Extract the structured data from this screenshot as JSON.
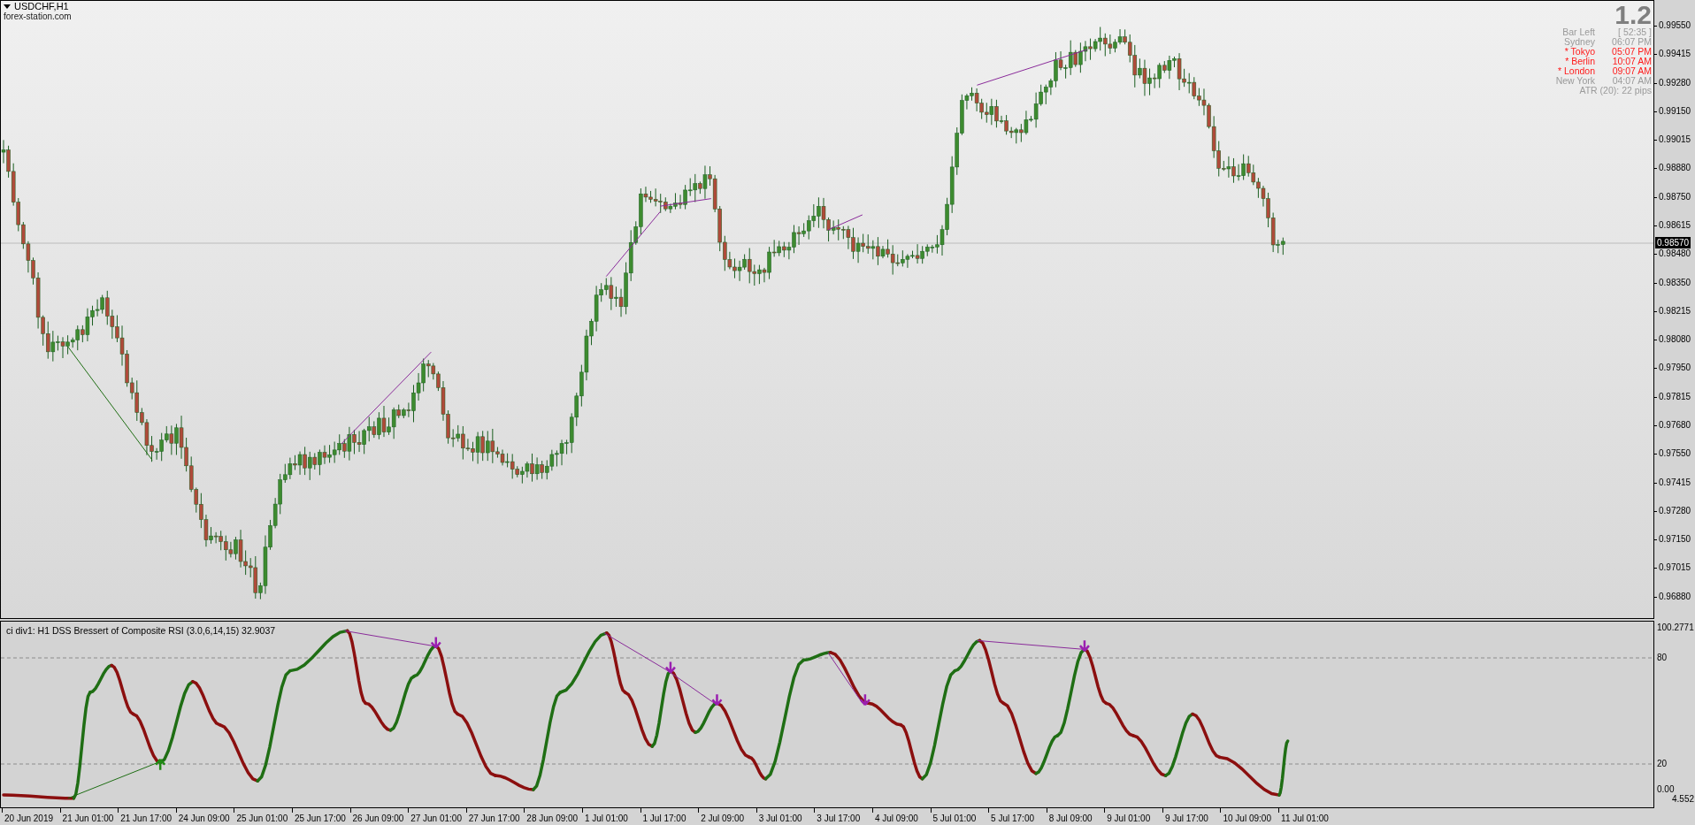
{
  "chart": {
    "symbol": "USDCHF,H1",
    "source": "forex-station.com",
    "spread": "1.2",
    "info_rows": [
      {
        "label": "Bar Left",
        "value": "[ 52:35 ]",
        "active": false
      },
      {
        "label": "Sydney",
        "value": "06:07 PM",
        "active": false
      },
      {
        "label": "* Tokyo",
        "value": "05:07 PM",
        "active": true
      },
      {
        "label": "* Berlin",
        "value": "10:07 AM",
        "active": true
      },
      {
        "label": "* London",
        "value": "09:07 AM",
        "active": true
      },
      {
        "label": "New York",
        "value": "04:07 AM",
        "active": false
      }
    ],
    "atr": "ATR (20): 22 pips",
    "price_axis": [
      "0.99550",
      "0.99415",
      "0.99280",
      "0.99150",
      "0.99015",
      "0.98880",
      "0.98750",
      "0.98615",
      "0.98480",
      "0.98350",
      "0.98215",
      "0.98080",
      "0.97950",
      "0.97815",
      "0.97680",
      "0.97550",
      "0.97415",
      "0.97280",
      "0.97150",
      "0.97015",
      "0.96880"
    ],
    "current_price": "0.98570"
  },
  "indicator": {
    "title": "ci div1: H1 DSS Bressert of Composite RSI (3.0,6,14,15) 32.9037",
    "max": "100.2771",
    "upper": "80",
    "lower": "20",
    "zero": "0.00",
    "min": "4.552"
  },
  "time_axis": [
    "20 Jun 2019",
    "21 Jun 01:00",
    "21 Jun 17:00",
    "24 Jun 09:00",
    "25 Jun 01:00",
    "25 Jun 17:00",
    "26 Jun 09:00",
    "27 Jun 01:00",
    "27 Jun 17:00",
    "28 Jun 09:00",
    "1 Jul 01:00",
    "1 Jul 17:00",
    "2 Jul 09:00",
    "3 Jul 01:00",
    "3 Jul 17:00",
    "4 Jul 09:00",
    "5 Jul 01:00",
    "5 Jul 17:00",
    "8 Jul 09:00",
    "9 Jul 01:00",
    "9 Jul 17:00",
    "10 Jul 09:00",
    "11 Jul 01:00"
  ]
}
